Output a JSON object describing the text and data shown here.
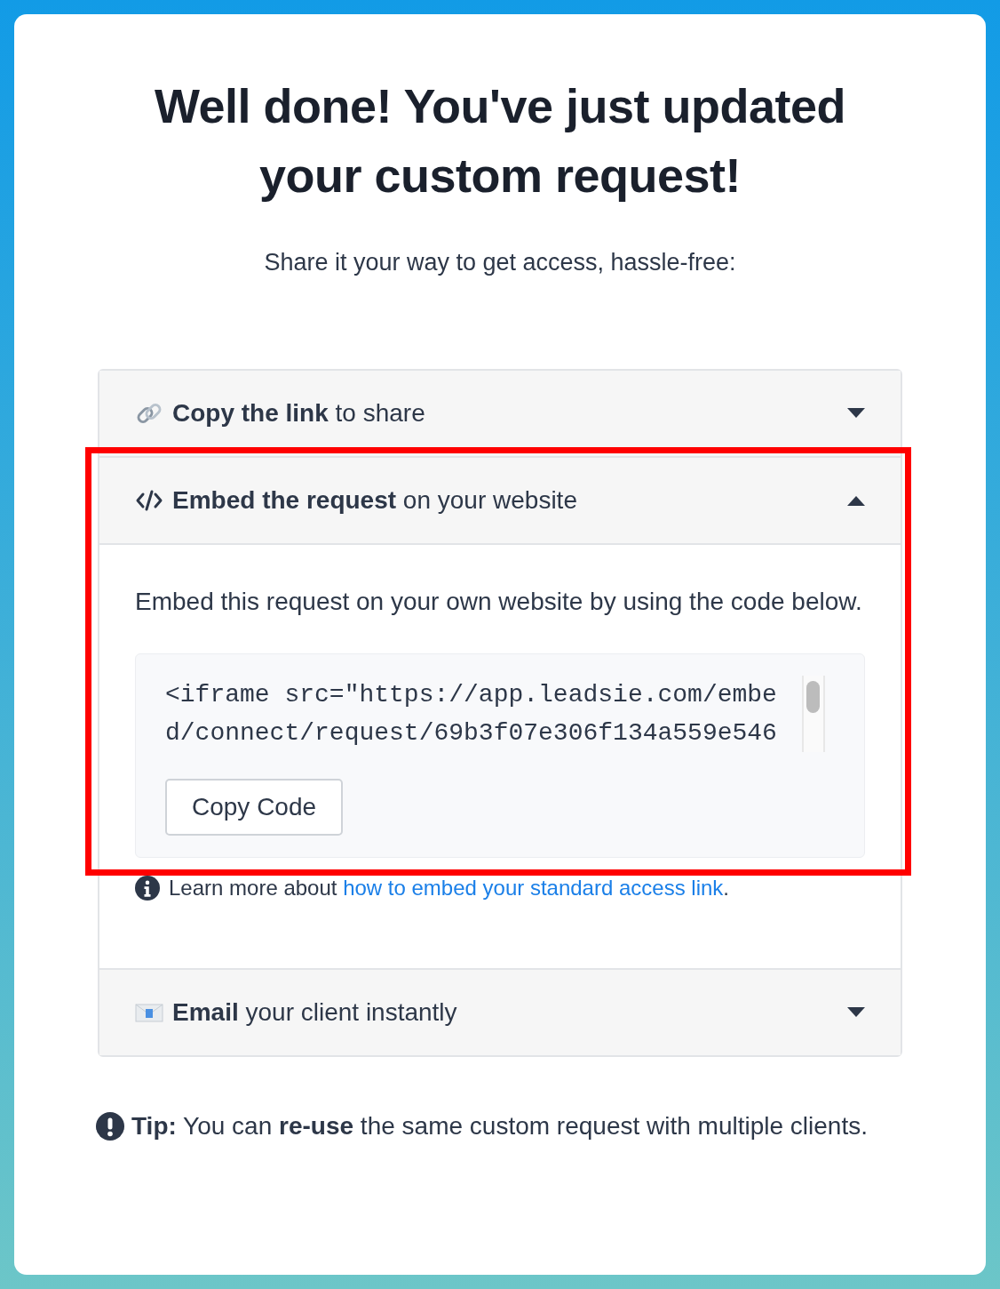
{
  "title": "Well done! You've just updated your custom request!",
  "subtitle": "Share it your way to get access, hassle-free:",
  "accordion": [
    {
      "label": "**Copy the link** to share",
      "expanded": false,
      "highlighted": false
    },
    {
      "label": "**Embed the request** on your website",
      "expanded": true,
      "highlighted": true,
      "body": {
        "text": "Embed this request on your own website by using the code below.",
        "code": "<iframe src=\"https://app.leadsie.com/embed/connect/request/69b3f07e306f134a559e546",
        "button": "Copy Code",
        "note": "Learn more about ",
        "link": "how to embed your standard access link",
        "note_end": "."
      }
    },
    {
      "label": "**Email** your client instantly",
      "expanded": false,
      "highlighted": false
    }
  ],
  "tip": "**Tip:** You can **re-use** the same custom request with multiple clients."
}
